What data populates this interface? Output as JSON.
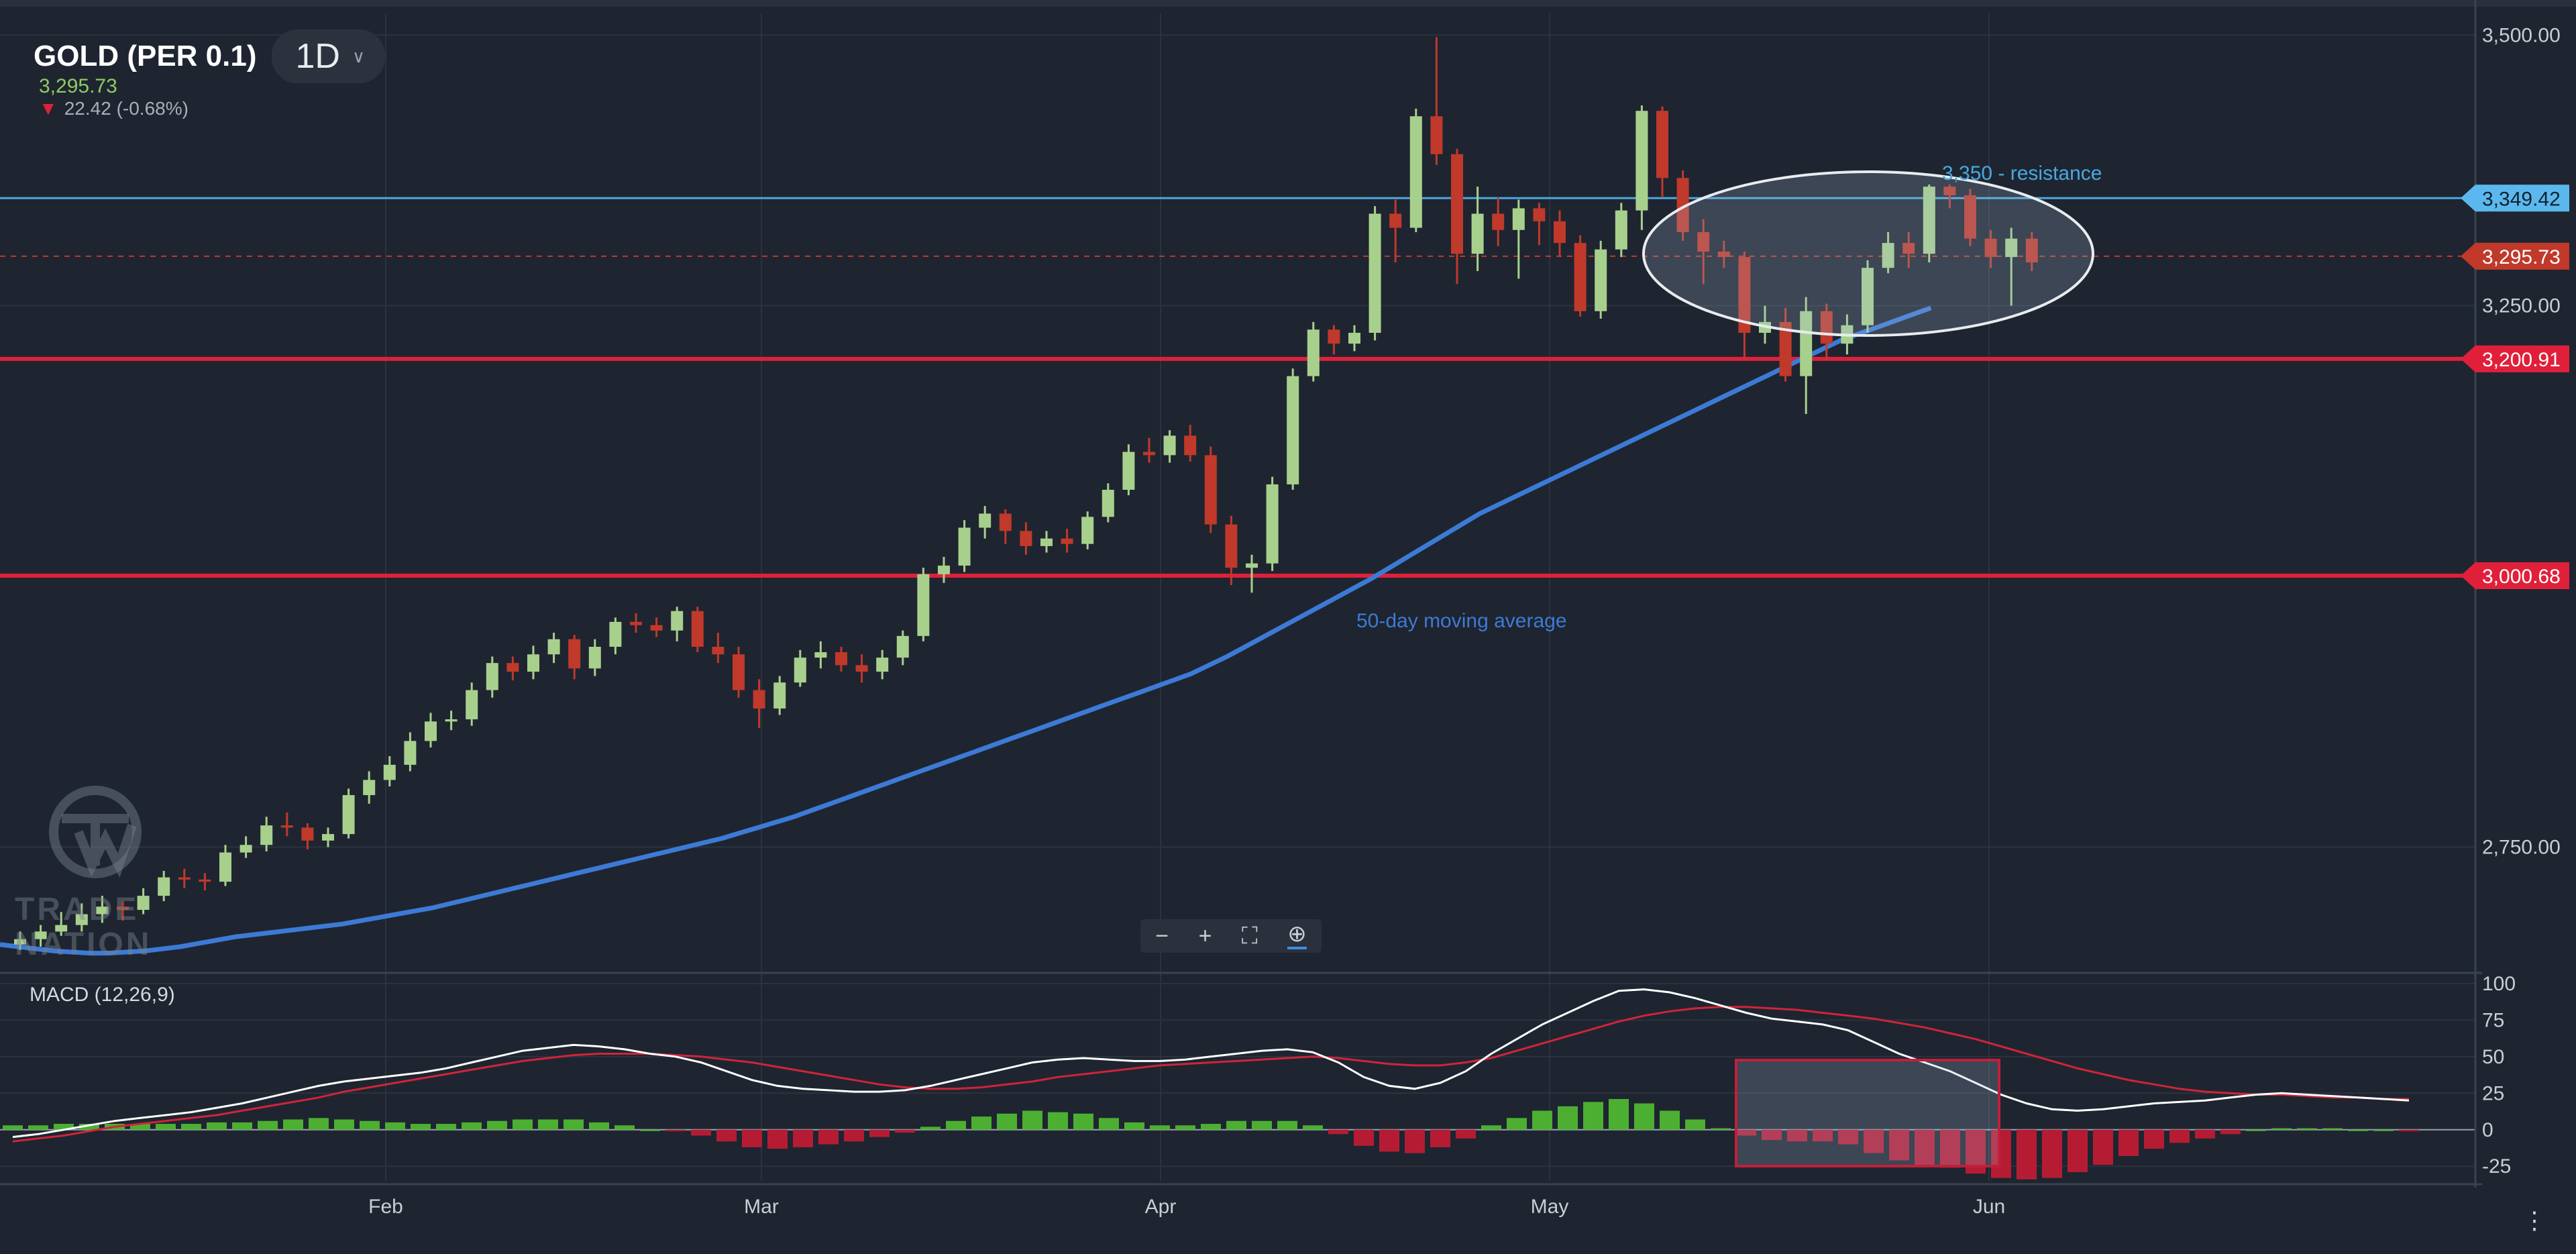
{
  "header": {
    "symbol": "GOLD (PER 0.1)",
    "timeframe": "1D",
    "last_price": "3,295.73",
    "change": "22.42 (-0.68%)"
  },
  "brand": {
    "line1": "TRADE",
    "line2": "NATION"
  },
  "colors": {
    "background": "#1e2530",
    "up_candle": "#a8d08d",
    "down_candle": "#c0392b",
    "moving_average": "#3d7ad6",
    "support_line": "#e0203a",
    "resistance_line": "#4aa8e0",
    "macd_line": "#ffffff",
    "signal_line": "#d0243a",
    "hist_pos": "#4caf32",
    "hist_neg": "#b51c34"
  },
  "annotations": {
    "resistance_text": "3,350 - resistance",
    "ma_text": "50-day moving average"
  },
  "macd_label": "MACD (12,26,9)",
  "chart_data": [
    {
      "type": "candlestick",
      "title": "GOLD (PER 0.1)",
      "x_tick_labels": [
        "Feb",
        "Mar",
        "Apr",
        "May",
        "Jun"
      ],
      "y_tick_labels": [
        "3,500.00",
        "3,250.00",
        "2,750.00"
      ],
      "y_ticks": [
        3500,
        3250,
        2750
      ],
      "ylim": [
        2640,
        3520
      ],
      "horizontal_lines": [
        {
          "label": "3,349.42",
          "value": 3349.42,
          "style": "resistance"
        },
        {
          "label": "3,295.73",
          "value": 3295.73,
          "style": "last"
        },
        {
          "label": "3,200.91",
          "value": 3200.91,
          "style": "support"
        },
        {
          "label": "3,000.68",
          "value": 3000.68,
          "style": "support"
        }
      ],
      "candles": [
        [
          2660,
          2665,
          2672,
          2655
        ],
        [
          2665,
          2672,
          2678,
          2658
        ],
        [
          2672,
          2678,
          2690,
          2668
        ],
        [
          2678,
          2688,
          2698,
          2672
        ],
        [
          2688,
          2695,
          2705,
          2680
        ],
        [
          2695,
          2692,
          2700,
          2682
        ],
        [
          2692,
          2705,
          2712,
          2688
        ],
        [
          2705,
          2722,
          2728,
          2700
        ],
        [
          2722,
          2720,
          2730,
          2712
        ],
        [
          2720,
          2718,
          2726,
          2710
        ],
        [
          2718,
          2745,
          2752,
          2714
        ],
        [
          2745,
          2752,
          2760,
          2740
        ],
        [
          2752,
          2770,
          2778,
          2746
        ],
        [
          2770,
          2768,
          2782,
          2760
        ],
        [
          2768,
          2756,
          2772,
          2748
        ],
        [
          2756,
          2762,
          2768,
          2750
        ],
        [
          2762,
          2798,
          2804,
          2758
        ],
        [
          2798,
          2812,
          2820,
          2790
        ],
        [
          2812,
          2826,
          2834,
          2806
        ],
        [
          2826,
          2848,
          2856,
          2820
        ],
        [
          2848,
          2866,
          2874,
          2842
        ],
        [
          2866,
          2868,
          2876,
          2858
        ],
        [
          2868,
          2895,
          2902,
          2862
        ],
        [
          2895,
          2920,
          2926,
          2888
        ],
        [
          2920,
          2912,
          2926,
          2904
        ],
        [
          2912,
          2928,
          2936,
          2905
        ],
        [
          2928,
          2942,
          2948,
          2920
        ],
        [
          2942,
          2915,
          2946,
          2905
        ],
        [
          2915,
          2935,
          2942,
          2908
        ],
        [
          2935,
          2958,
          2962,
          2928
        ],
        [
          2958,
          2955,
          2966,
          2948
        ],
        [
          2955,
          2950,
          2962,
          2944
        ],
        [
          2950,
          2968,
          2972,
          2940
        ],
        [
          2968,
          2935,
          2972,
          2930
        ],
        [
          2935,
          2928,
          2948,
          2920
        ],
        [
          2928,
          2895,
          2935,
          2888
        ],
        [
          2895,
          2878,
          2905,
          2860
        ],
        [
          2878,
          2902,
          2908,
          2872
        ],
        [
          2902,
          2925,
          2932,
          2898
        ],
        [
          2925,
          2930,
          2940,
          2915
        ],
        [
          2930,
          2918,
          2935,
          2912
        ],
        [
          2918,
          2912,
          2928,
          2902
        ],
        [
          2912,
          2925,
          2932,
          2905
        ],
        [
          2925,
          2945,
          2950,
          2918
        ],
        [
          2945,
          3002,
          3008,
          2940
        ],
        [
          3002,
          3010,
          3018,
          2994
        ],
        [
          3010,
          3045,
          3052,
          3004
        ],
        [
          3045,
          3058,
          3065,
          3035
        ],
        [
          3058,
          3042,
          3062,
          3030
        ],
        [
          3042,
          3028,
          3050,
          3020
        ],
        [
          3028,
          3035,
          3042,
          3022
        ],
        [
          3035,
          3030,
          3044,
          3022
        ],
        [
          3030,
          3055,
          3060,
          3025
        ],
        [
          3055,
          3080,
          3086,
          3050
        ],
        [
          3080,
          3115,
          3122,
          3075
        ],
        [
          3115,
          3112,
          3128,
          3105
        ],
        [
          3112,
          3130,
          3135,
          3105
        ],
        [
          3130,
          3112,
          3140,
          3106
        ],
        [
          3112,
          3048,
          3120,
          3040
        ],
        [
          3048,
          3008,
          3056,
          2992
        ],
        [
          3008,
          3012,
          3020,
          2985
        ],
        [
          3012,
          3085,
          3092,
          3005
        ],
        [
          3085,
          3185,
          3192,
          3080
        ],
        [
          3185,
          3228,
          3235,
          3180
        ],
        [
          3228,
          3215,
          3232,
          3205
        ],
        [
          3215,
          3225,
          3232,
          3208
        ],
        [
          3225,
          3335,
          3342,
          3218
        ],
        [
          3335,
          3322,
          3348,
          3290
        ],
        [
          3322,
          3425,
          3432,
          3318
        ],
        [
          3425,
          3390,
          3498,
          3380
        ],
        [
          3390,
          3298,
          3395,
          3270
        ],
        [
          3298,
          3335,
          3360,
          3282
        ],
        [
          3335,
          3320,
          3350,
          3305
        ],
        [
          3320,
          3340,
          3348,
          3275
        ],
        [
          3340,
          3328,
          3345,
          3306
        ],
        [
          3328,
          3308,
          3338,
          3295
        ],
        [
          3308,
          3245,
          3315,
          3240
        ],
        [
          3245,
          3302,
          3310,
          3238
        ],
        [
          3302,
          3338,
          3345,
          3295
        ],
        [
          3338,
          3430,
          3435,
          3320
        ],
        [
          3430,
          3368,
          3434,
          3350
        ],
        [
          3368,
          3318,
          3375,
          3310
        ],
        [
          3318,
          3300,
          3330,
          3270
        ],
        [
          3300,
          3295,
          3310,
          3285
        ],
        [
          3295,
          3225,
          3300,
          3200
        ],
        [
          3225,
          3235,
          3250,
          3215
        ],
        [
          3235,
          3185,
          3248,
          3180
        ],
        [
          3185,
          3245,
          3258,
          3150
        ],
        [
          3245,
          3215,
          3252,
          3200
        ],
        [
          3215,
          3232,
          3242,
          3205
        ],
        [
          3232,
          3285,
          3292,
          3225
        ],
        [
          3285,
          3308,
          3318,
          3280
        ],
        [
          3308,
          3298,
          3318,
          3285
        ],
        [
          3298,
          3360,
          3362,
          3290
        ],
        [
          3360,
          3352,
          3362,
          3340
        ],
        [
          3352,
          3312,
          3358,
          3305
        ],
        [
          3312,
          3295,
          3320,
          3285
        ],
        [
          3295,
          3312,
          3322,
          3250
        ],
        [
          3312,
          3290,
          3318,
          3282
        ]
      ],
      "moving_average": [
        2660,
        2658,
        2656,
        2654,
        2653,
        2652,
        2652,
        2653,
        2654,
        2656,
        2658,
        2661,
        2664,
        2667,
        2669,
        2671,
        2673,
        2675,
        2677,
        2679,
        2682,
        2685,
        2688,
        2691,
        2694,
        2698,
        2702,
        2706,
        2710,
        2714,
        2718,
        2722,
        2726,
        2730,
        2734,
        2738,
        2742,
        2746,
        2750,
        2754,
        2758,
        2763,
        2768,
        2773,
        2778,
        2784,
        2790,
        2796,
        2802,
        2808,
        2814,
        2820,
        2826,
        2832,
        2838,
        2844,
        2850,
        2856,
        2862,
        2868,
        2874,
        2880,
        2886,
        2892,
        2898,
        2904,
        2910,
        2918,
        2926,
        2935,
        2944,
        2953,
        2962,
        2971,
        2980,
        2989,
        2998,
        3008,
        3018,
        3028,
        3038,
        3048,
        3058,
        3066,
        3074,
        3082,
        3090,
        3098,
        3106,
        3114,
        3122,
        3130,
        3138,
        3146,
        3154,
        3162,
        3170,
        3178,
        3186,
        3194,
        3202,
        3210,
        3218,
        3224,
        3230,
        3236,
        3242,
        3248
      ]
    },
    {
      "type": "macd",
      "title": "MACD (12,26,9)",
      "y_tick_labels": [
        "100",
        "75",
        "50",
        "25",
        "0",
        "-25"
      ],
      "y_ticks": [
        100,
        75,
        50,
        25,
        0,
        -25
      ],
      "ylim": [
        -35,
        105
      ],
      "macd": [
        -5,
        -3,
        0,
        3,
        6,
        8,
        10,
        12,
        15,
        18,
        22,
        26,
        30,
        33,
        35,
        37,
        39,
        42,
        46,
        50,
        54,
        56,
        58,
        57,
        55,
        52,
        50,
        46,
        40,
        34,
        30,
        28,
        27,
        26,
        26,
        27,
        30,
        34,
        38,
        42,
        46,
        48,
        49,
        48,
        47,
        47,
        48,
        50,
        52,
        54,
        55,
        53,
        46,
        36,
        30,
        28,
        32,
        40,
        52,
        62,
        72,
        80,
        88,
        95,
        96,
        94,
        90,
        85,
        80,
        76,
        74,
        72,
        68,
        60,
        52,
        46,
        40,
        32,
        24,
        18,
        14,
        13,
        14,
        16,
        18,
        19,
        20,
        22,
        24,
        25,
        24,
        23,
        22,
        21,
        20
      ],
      "signal": [
        -8,
        -6,
        -4,
        -1,
        2,
        4,
        6,
        8,
        10,
        13,
        16,
        19,
        22,
        26,
        29,
        32,
        35,
        38,
        41,
        44,
        47,
        49,
        51,
        52,
        52,
        52,
        51,
        50,
        48,
        46,
        43,
        40,
        37,
        34,
        31,
        29,
        28,
        28,
        29,
        31,
        33,
        36,
        38,
        40,
        42,
        44,
        45,
        46,
        47,
        48,
        49,
        50,
        49,
        47,
        45,
        44,
        44,
        46,
        49,
        54,
        59,
        64,
        69,
        74,
        78,
        81,
        83,
        84,
        84,
        83,
        82,
        80,
        78,
        76,
        73,
        70,
        66,
        62,
        57,
        52,
        47,
        42,
        38,
        34,
        31,
        28,
        26,
        25,
        24,
        24,
        23,
        22,
        22,
        21,
        21
      ],
      "histogram": [
        3,
        3,
        4,
        4,
        4,
        4,
        4,
        4,
        5,
        5,
        6,
        7,
        8,
        7,
        6,
        5,
        4,
        4,
        5,
        6,
        7,
        7,
        7,
        5,
        3,
        0,
        -1,
        -4,
        -8,
        -12,
        -13,
        -12,
        -10,
        -8,
        -5,
        -2,
        2,
        6,
        9,
        11,
        13,
        12,
        11,
        8,
        5,
        3,
        3,
        4,
        6,
        6,
        6,
        3,
        -3,
        -11,
        -15,
        -16,
        -12,
        -6,
        3,
        8,
        13,
        16,
        19,
        21,
        18,
        13,
        7,
        1,
        -4,
        -7,
        -8,
        -8,
        -10,
        -16,
        -21,
        -24,
        -26,
        -30,
        -33,
        -34,
        -33,
        -29,
        -24,
        -18,
        -13,
        -9,
        -6,
        -3,
        0,
        1,
        1,
        1,
        0,
        0,
        -1
      ]
    }
  ]
}
